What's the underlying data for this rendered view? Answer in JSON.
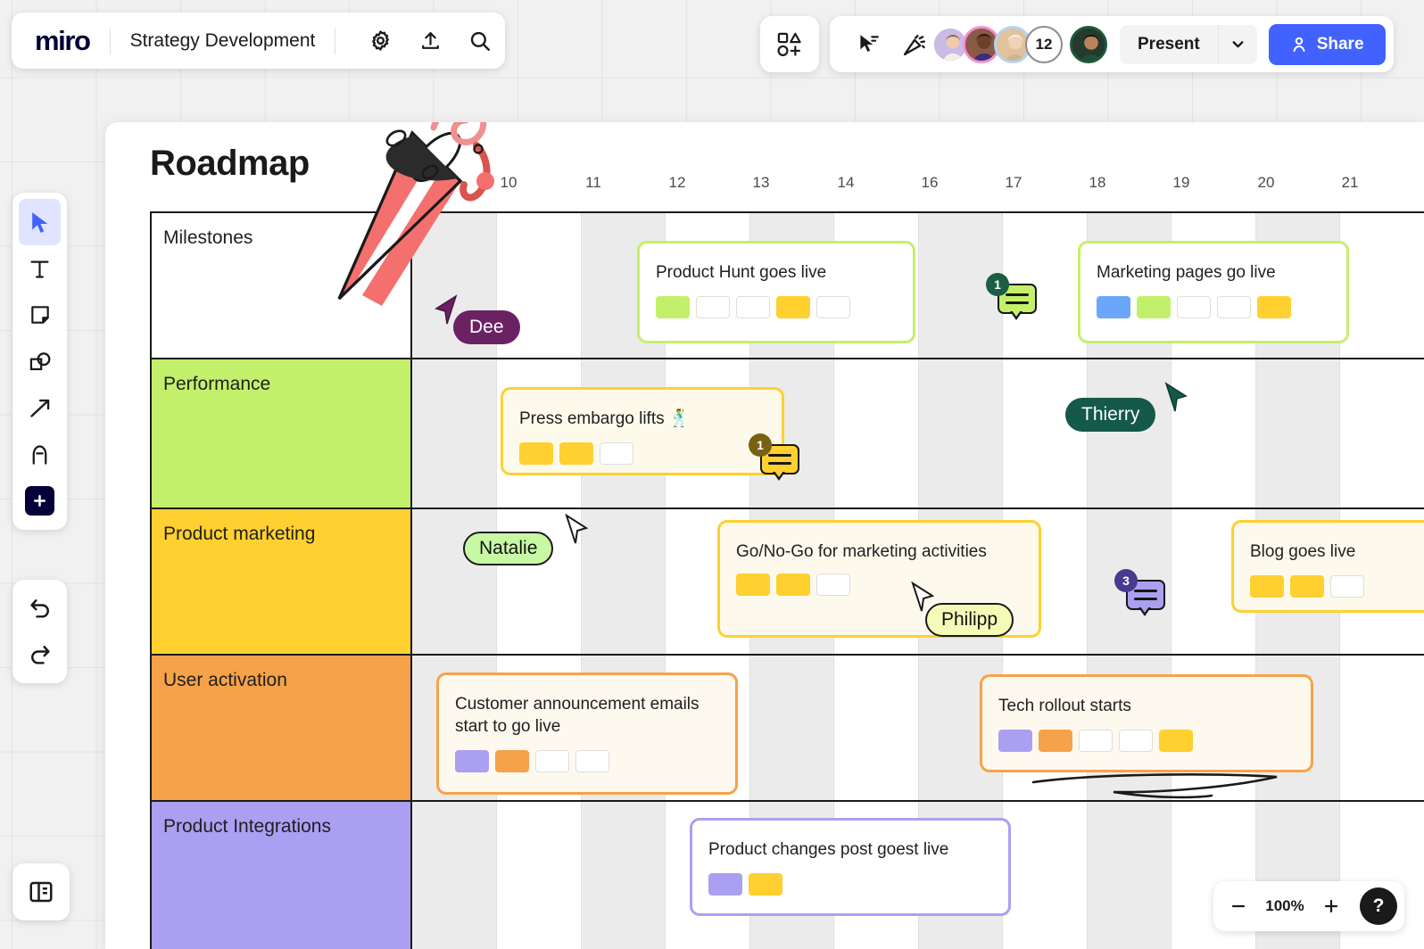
{
  "app": {
    "logo": "miro",
    "board_name": "Strategy Development",
    "zoom_level": "100%",
    "present_label": "Present",
    "share_label": "Share",
    "help_label": "?",
    "collaborator_overflow": "12",
    "icons": {
      "gear": "gear-icon",
      "upload": "upload-icon",
      "search": "search-icon",
      "shapes_add": "shapes-add-icon",
      "select_frame": "select-frame-icon",
      "celebrate": "celebrate-icon",
      "share_person": "person-icon",
      "caret": "chevron-down-icon"
    }
  },
  "tools": [
    {
      "name": "cursor-tool",
      "icon": "cursor-icon",
      "active": true
    },
    {
      "name": "text-tool",
      "icon": "text-icon",
      "active": false
    },
    {
      "name": "sticky-note-tool",
      "icon": "sticky-note-icon",
      "active": false
    },
    {
      "name": "shapes-tool",
      "icon": "shapes-icon",
      "active": false
    },
    {
      "name": "arrow-tool",
      "icon": "arrow-icon",
      "active": false
    },
    {
      "name": "pen-tool",
      "icon": "pen-icon",
      "active": false
    },
    {
      "name": "more-apps-tool",
      "icon": "plus-icon",
      "active": false
    }
  ],
  "history": [
    {
      "name": "undo-button",
      "icon": "undo-icon"
    },
    {
      "name": "redo-button",
      "icon": "redo-icon"
    }
  ],
  "board": {
    "title": "Roadmap",
    "timeline_ticks": [
      "10",
      "11",
      "12",
      "13",
      "14",
      "16",
      "17",
      "18",
      "19",
      "20",
      "21"
    ],
    "lanes": [
      {
        "label": "Milestones",
        "color": "#ffffff"
      },
      {
        "label": "Performance",
        "color": "#c3f06a"
      },
      {
        "label": "Product marketing",
        "color": "#ffd02f"
      },
      {
        "label": "User activation",
        "color": "#f6a24a"
      },
      {
        "label": "Product Integrations",
        "color": "#ab9ff2"
      }
    ],
    "cards": [
      {
        "name": "card-product-hunt",
        "lane": "Milestones",
        "title": "Product Hunt goes live",
        "chips": [
          "#c3f06a",
          "",
          "",
          "#ffd02f",
          ""
        ]
      },
      {
        "name": "card-marketing-pages",
        "lane": "Milestones",
        "title": "Marketing pages go live",
        "chips": [
          "#6ba6fb",
          "#c3f06a",
          "",
          "",
          "#ffd02f"
        ]
      },
      {
        "name": "card-press-embargo",
        "lane": "Performance",
        "title": "Press embargo lifts 🕺",
        "chips": [
          "#ffd02f",
          "#ffd02f",
          ""
        ]
      },
      {
        "name": "card-go-no-go",
        "lane": "Product marketing",
        "title": "Go/No-Go for marketing activities",
        "chips": [
          "#ffd02f",
          "#ffd02f",
          ""
        ]
      },
      {
        "name": "card-blog-goes-live",
        "lane": "Product marketing",
        "title": "Blog goes live",
        "chips": [
          "#ffd02f",
          "#ffd02f",
          ""
        ]
      },
      {
        "name": "card-customer-announcement",
        "lane": "User activation",
        "title": "Customer announcement emails start to go live",
        "chips": [
          "#ab9ff2",
          "#f6a24a",
          "",
          ""
        ]
      },
      {
        "name": "card-tech-rollout",
        "lane": "User activation",
        "title": "Tech rollout starts",
        "chips": [
          "#ab9ff2",
          "#f6a24a",
          "",
          "",
          "#ffd02f"
        ]
      },
      {
        "name": "card-product-changes",
        "lane": "Product Integrations",
        "title": "Product changes post goest live",
        "chips": [
          "#ab9ff2",
          "#ffd02f"
        ]
      }
    ],
    "comments": [
      {
        "name": "comment-marketing-pages",
        "count": "1",
        "bubble_color": "#c3f06a",
        "badge_color": "#1b5e43"
      },
      {
        "name": "comment-press-embargo",
        "count": "1",
        "bubble_color": "#ffd02f",
        "badge_color": "#7a6111"
      },
      {
        "name": "comment-blog",
        "count": "3",
        "bubble_color": "#ab9ff2",
        "badge_color": "#483b8e"
      }
    ],
    "cursors": [
      {
        "name": "cursor-dee",
        "label": "Dee",
        "bg": "#6b2263",
        "fg": "#ffffff"
      },
      {
        "name": "cursor-thierry",
        "label": "Thierry",
        "bg": "#14594a",
        "fg": "#ffffff"
      },
      {
        "name": "cursor-natalie",
        "label": "Natalie",
        "bg": "#c7f9a4",
        "fg": "#111111"
      },
      {
        "name": "cursor-philipp",
        "label": "Philipp",
        "bg": "#f4fbb6",
        "fg": "#111111"
      }
    ],
    "decoration": "party-popper-sticker"
  }
}
